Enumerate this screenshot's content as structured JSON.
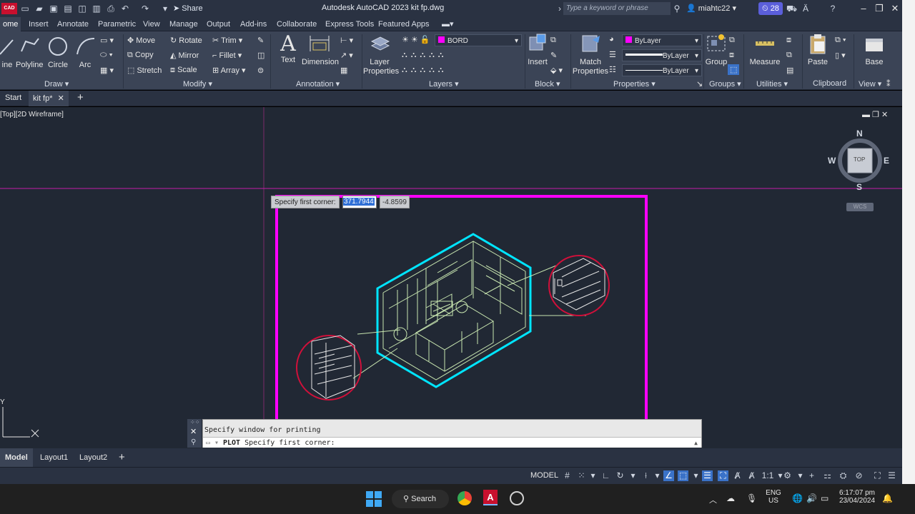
{
  "titlebar": {
    "app_badge": "CAD",
    "share": "Share",
    "title": "Autodesk AutoCAD 2023   kit fp.dwg",
    "search_placeholder": "Type a keyword or phrase",
    "user": "miahtc22",
    "notifications": "28"
  },
  "ribbon_tabs": [
    "ome",
    "Insert",
    "Annotate",
    "Parametric",
    "View",
    "Manage",
    "Output",
    "Add-ins",
    "Collaborate",
    "Express Tools",
    "Featured Apps"
  ],
  "ribbon": {
    "draw": {
      "label": "Draw",
      "polyline": "Polyline",
      "circle": "Circle",
      "arc": "Arc",
      "line": "ine"
    },
    "modify": {
      "label": "Modify",
      "move": "Move",
      "rotate": "Rotate",
      "trim": "Trim",
      "copy": "Copy",
      "mirror": "Mirror",
      "fillet": "Fillet",
      "stretch": "Stretch",
      "scale": "Scale",
      "array": "Array"
    },
    "annotation": {
      "label": "Annotation",
      "text": "Text",
      "dimension": "Dimension"
    },
    "layers": {
      "label": "Layers",
      "properties": "Layer Properties",
      "current_layer": "BORD"
    },
    "block": {
      "label": "Block",
      "insert": "Insert"
    },
    "properties": {
      "label": "Properties",
      "match": "Match Properties",
      "color": "ByLayer",
      "linetype": "ByLayer",
      "lineweight": "ByLayer"
    },
    "groups": {
      "label": "Groups",
      "group": "Group"
    },
    "utilities": {
      "label": "Utilities",
      "measure": "Measure"
    },
    "clipboard": {
      "label": "Clipboard",
      "paste": "Paste"
    },
    "view": {
      "label": "View",
      "base": "Base"
    }
  },
  "file_tabs": {
    "start": "Start",
    "active": "kit fp*"
  },
  "viewport": {
    "label": "[Top][2D Wireframe]",
    "tooltip": "Specify first corner:",
    "coord_x": "371.7944",
    "coord_y": "-4.8599",
    "viewcube": {
      "n": "N",
      "s": "S",
      "e": "E",
      "w": "W",
      "face": "TOP",
      "wcs": "WCS"
    },
    "ucs_y": "Y"
  },
  "command": {
    "history": "Specify window for printing",
    "input_cmd": "PLOT",
    "input_prompt": "Specify first corner:"
  },
  "layout_tabs": [
    "Model",
    "Layout1",
    "Layout2"
  ],
  "status": {
    "model": "MODEL",
    "scale": "1:1"
  },
  "taskbar": {
    "search": "Search",
    "lang": "ENG",
    "region": "US",
    "time": "6:17:07 pm",
    "date": "23/04/2024"
  },
  "colors": {
    "accent": "#3a72c8",
    "magenta": "#ff00ff",
    "cyan": "#00e5ff",
    "red": "#d0103a",
    "linework": "#c8e6b0"
  }
}
